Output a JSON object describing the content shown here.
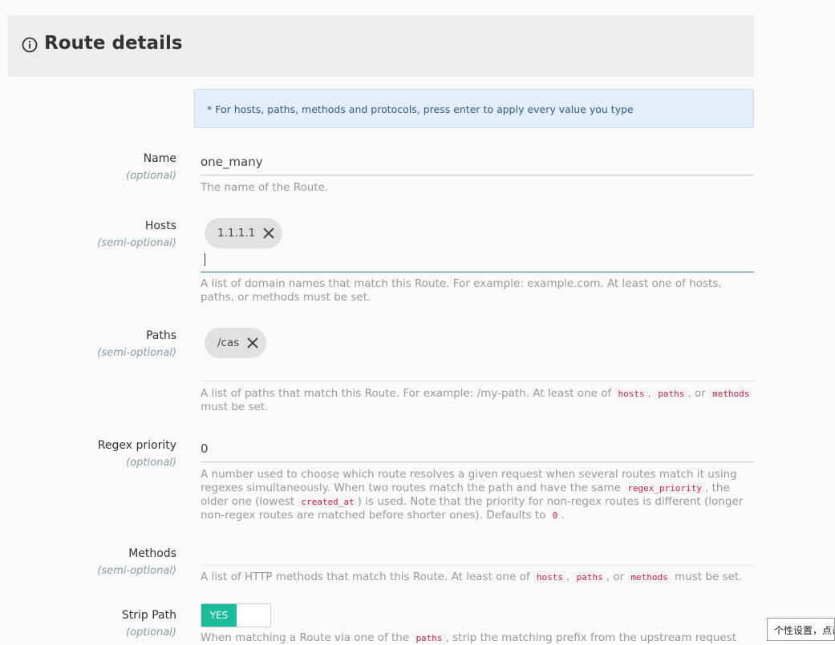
{
  "header": {
    "title": "Route details",
    "icon": "info-circle-icon"
  },
  "notice": "* For hosts, paths, methods and protocols, press enter to apply every value you type",
  "fields": {
    "name": {
      "label": "Name",
      "optional": "(optional)",
      "value": "one_many",
      "help": "The name of the Route."
    },
    "hosts": {
      "label": "Hosts",
      "optional": "(semi-optional)",
      "chips": [
        "1.1.1.1"
      ],
      "help": "A list of domain names that match this Route. For example: example.com. At least one of hosts, paths, or methods must be set."
    },
    "paths": {
      "label": "Paths",
      "optional": "(semi-optional)",
      "chips": [
        "/cas"
      ],
      "help_before": "A list of paths that match this Route. For example: /my-path. At least one of",
      "code1": "hosts",
      "sep1": ",",
      "code2": "paths",
      "sep2": ", or",
      "code3": "methods",
      "help_after": "must be set."
    },
    "regex_priority": {
      "label": "Regex priority",
      "optional": "(optional)",
      "value": "0",
      "help_1": "A number used to choose which route resolves a given request when several routes match it using regexes simultaneously. When two routes match the path and have the same",
      "code_regex": "regex_priority",
      "help_2": ", the older one (lowest",
      "code_created": "created_at",
      "help_3": ") is used. Note that the priority for non-regex routes is different (longer non-regex routes are matched before shorter ones). Defaults to",
      "code_zero": "0",
      "help_4": "."
    },
    "methods": {
      "label": "Methods",
      "optional": "(semi-optional)",
      "help_before": "A list of HTTP methods that match this Route. At least one of",
      "code1": "hosts",
      "sep1": ",",
      "code2": "paths",
      "sep2": ", or",
      "code3": "methods",
      "help_after": "must be set."
    },
    "strip_path": {
      "label": "Strip Path",
      "optional": "(optional)",
      "toggle_on": "YES",
      "help_before": "When matching a Route via one of the",
      "code": "paths",
      "help_after": ", strip the matching prefix from the upstream request"
    }
  },
  "tooltip": "个性设置，点击",
  "colors": {
    "accent": "#1abc9c",
    "notice_bg": "#e3eef8",
    "code": "#c7254e"
  }
}
